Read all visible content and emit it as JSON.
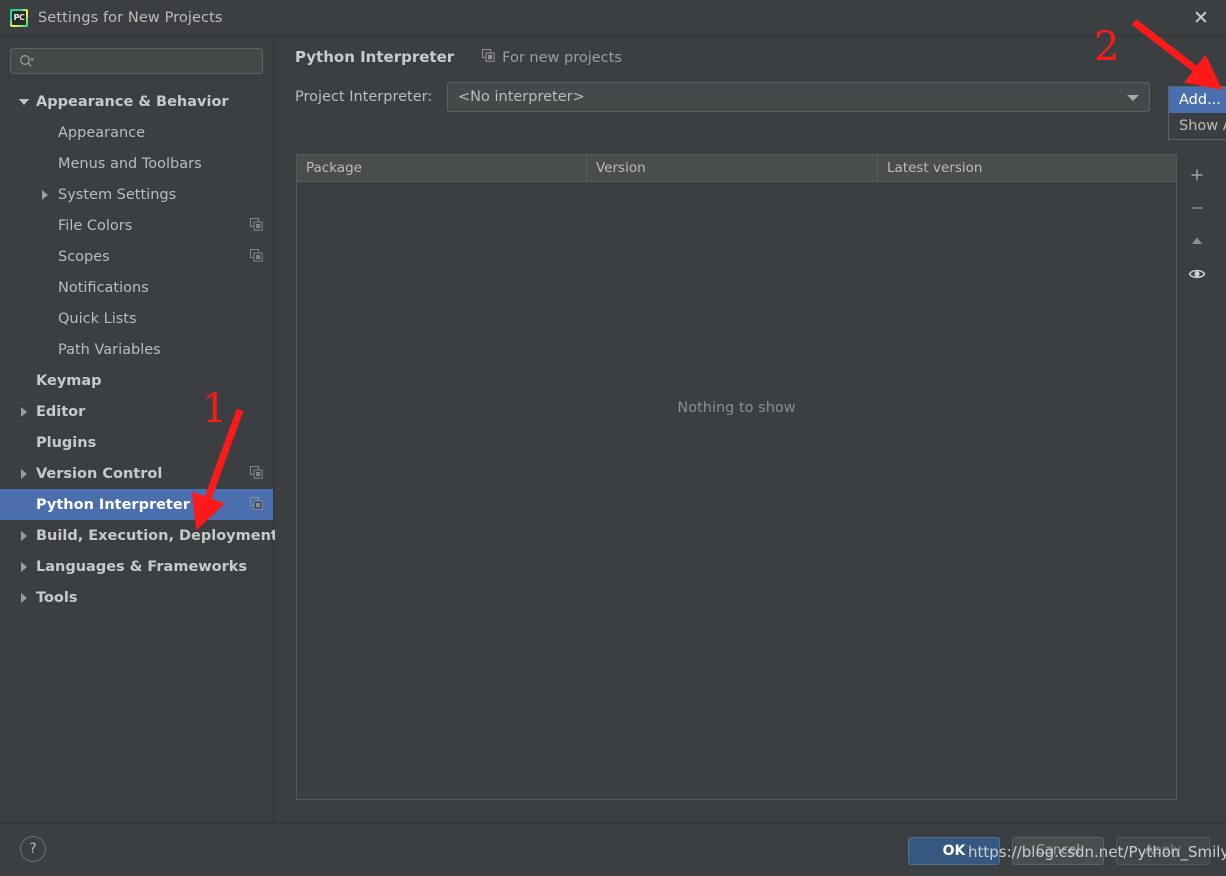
{
  "window": {
    "title": "Settings for New Projects",
    "app_icon": "pycharm-icon",
    "close_icon": "close-icon"
  },
  "sidebar": {
    "search": {
      "placeholder": "",
      "value": "",
      "icon": "search-icon"
    },
    "items": [
      {
        "label": "Appearance & Behavior",
        "level": 0,
        "twisty": "down",
        "selected": false,
        "badge": false
      },
      {
        "label": "Appearance",
        "level": 1,
        "twisty": "none",
        "selected": false,
        "badge": false
      },
      {
        "label": "Menus and Toolbars",
        "level": 1,
        "twisty": "none",
        "selected": false,
        "badge": false
      },
      {
        "label": "System Settings",
        "level": 1,
        "twisty": "right",
        "selected": false,
        "badge": false
      },
      {
        "label": "File Colors",
        "level": 1,
        "twisty": "none",
        "selected": false,
        "badge": true
      },
      {
        "label": "Scopes",
        "level": 1,
        "twisty": "none",
        "selected": false,
        "badge": true
      },
      {
        "label": "Notifications",
        "level": 1,
        "twisty": "none",
        "selected": false,
        "badge": false
      },
      {
        "label": "Quick Lists",
        "level": 1,
        "twisty": "none",
        "selected": false,
        "badge": false
      },
      {
        "label": "Path Variables",
        "level": 1,
        "twisty": "none",
        "selected": false,
        "badge": false
      },
      {
        "label": "Keymap",
        "level": 0,
        "twisty": "none",
        "selected": false,
        "badge": false
      },
      {
        "label": "Editor",
        "level": 0,
        "twisty": "right",
        "selected": false,
        "badge": false
      },
      {
        "label": "Plugins",
        "level": 0,
        "twisty": "none",
        "selected": false,
        "badge": false
      },
      {
        "label": "Version Control",
        "level": 0,
        "twisty": "right",
        "selected": false,
        "badge": true
      },
      {
        "label": "Python Interpreter",
        "level": 0,
        "twisty": "none",
        "selected": true,
        "badge": true
      },
      {
        "label": "Build, Execution, Deployment",
        "level": 0,
        "twisty": "right",
        "selected": false,
        "badge": false
      },
      {
        "label": "Languages & Frameworks",
        "level": 0,
        "twisty": "right",
        "selected": false,
        "badge": false
      },
      {
        "label": "Tools",
        "level": 0,
        "twisty": "right",
        "selected": false,
        "badge": false
      }
    ]
  },
  "main": {
    "page_title": "Python Interpreter",
    "scope_chip": {
      "label": "For new projects",
      "icon": "copy-scope-icon"
    },
    "interpreter_row": {
      "label": "Project Interpreter:",
      "value": "<No interpreter>",
      "dropdown_icon": "chevron-down-icon"
    },
    "gear_menu": {
      "items": [
        {
          "label": "Add...",
          "active": true
        },
        {
          "label": "Show A",
          "active": false
        }
      ]
    },
    "packages_table": {
      "columns": [
        "Package",
        "Version",
        "Latest version"
      ],
      "rows": [],
      "empty_message": "Nothing to show"
    },
    "table_tools": [
      {
        "name": "add-package-button",
        "glyph": "+"
      },
      {
        "name": "remove-package-button",
        "glyph": "−"
      },
      {
        "name": "upgrade-package-button",
        "glyph": "▲"
      },
      {
        "name": "show-early-releases-button",
        "glyph": "eye"
      }
    ]
  },
  "footer": {
    "help_label": "?",
    "ok_label": "OK",
    "cancel_label": "Cancel",
    "apply_label": "Apply"
  },
  "overlay": {
    "watermark": "https://blog.csdn.net/Python_Smily",
    "annotations": [
      {
        "number": "1",
        "target": "sidebar-item-python-interpreter"
      },
      {
        "number": "2",
        "target": "add-interpreter-menu-item"
      }
    ]
  },
  "colors": {
    "background": "#3c3f41",
    "selection": "#4b6eaf",
    "ok_button": "#365880",
    "annotation": "#ff1a1a",
    "text": "#b9bcbd"
  }
}
